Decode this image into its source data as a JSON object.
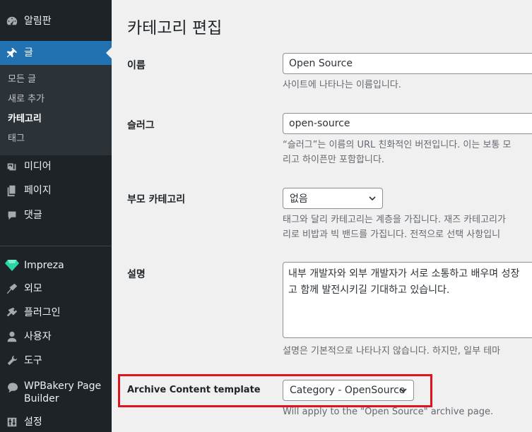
{
  "sidebar": {
    "items": [
      {
        "label": "알림판",
        "icon": "dashboard-icon"
      },
      {
        "label": "글",
        "icon": "pin-icon"
      },
      {
        "label": "미디어",
        "icon": "media-icon"
      },
      {
        "label": "페이지",
        "icon": "pages-icon"
      },
      {
        "label": "댓글",
        "icon": "comments-icon"
      },
      {
        "label": "Impreza",
        "icon": "diamond-icon"
      },
      {
        "label": "외모",
        "icon": "appearance-icon"
      },
      {
        "label": "플러그인",
        "icon": "plugins-icon"
      },
      {
        "label": "사용자",
        "icon": "users-icon"
      },
      {
        "label": "도구",
        "icon": "tools-icon"
      },
      {
        "label": "WPBakery Page Builder",
        "label_line1": "WPBakery Page",
        "label_line2": "Builder",
        "icon": "wpbakery-icon"
      },
      {
        "label": "설정",
        "icon": "settings-icon"
      }
    ],
    "submenu": [
      {
        "label": "모든 글"
      },
      {
        "label": "새로 추가"
      },
      {
        "label": "카테고리",
        "current": true
      },
      {
        "label": "태그"
      }
    ],
    "active_color": "#2271b1"
  },
  "main": {
    "title": "카테고리 편집",
    "name": {
      "label": "이름",
      "value": "Open Source",
      "description": "사이트에 나타나는 이름입니다."
    },
    "slug": {
      "label": "슬러그",
      "value": "open-source",
      "description_line1": "“슬러그”는 이름의 URL 친화적인 버전입니다. 이는 보통 모",
      "description_line2": "리고 하이픈만 포함합니다."
    },
    "parent": {
      "label": "부모 카테고리",
      "selected": "없음",
      "description_line1": "태그와 달리 카테고리는 계층을 가집니다. 재즈 카테고리가",
      "description_line2": "리로 비밥과 빅 밴드를 가집니다. 전적으로 선택 사항입니"
    },
    "description": {
      "label": "설명",
      "value": "내부 개발자와 외부 개발자가 서로 소통하고 배우며 성장\n고 함께 발전시키길 기대하고 있습니다.",
      "help": "설명은 기본적으로 나타나지 않습니다. 하지만, 일부 테마"
    },
    "archive_template": {
      "label": "Archive Content template",
      "selected": "Category - OpenSource",
      "help": "Will apply to the \"Open Source\" archive page.",
      "highlight_color": "#e0141e"
    }
  }
}
